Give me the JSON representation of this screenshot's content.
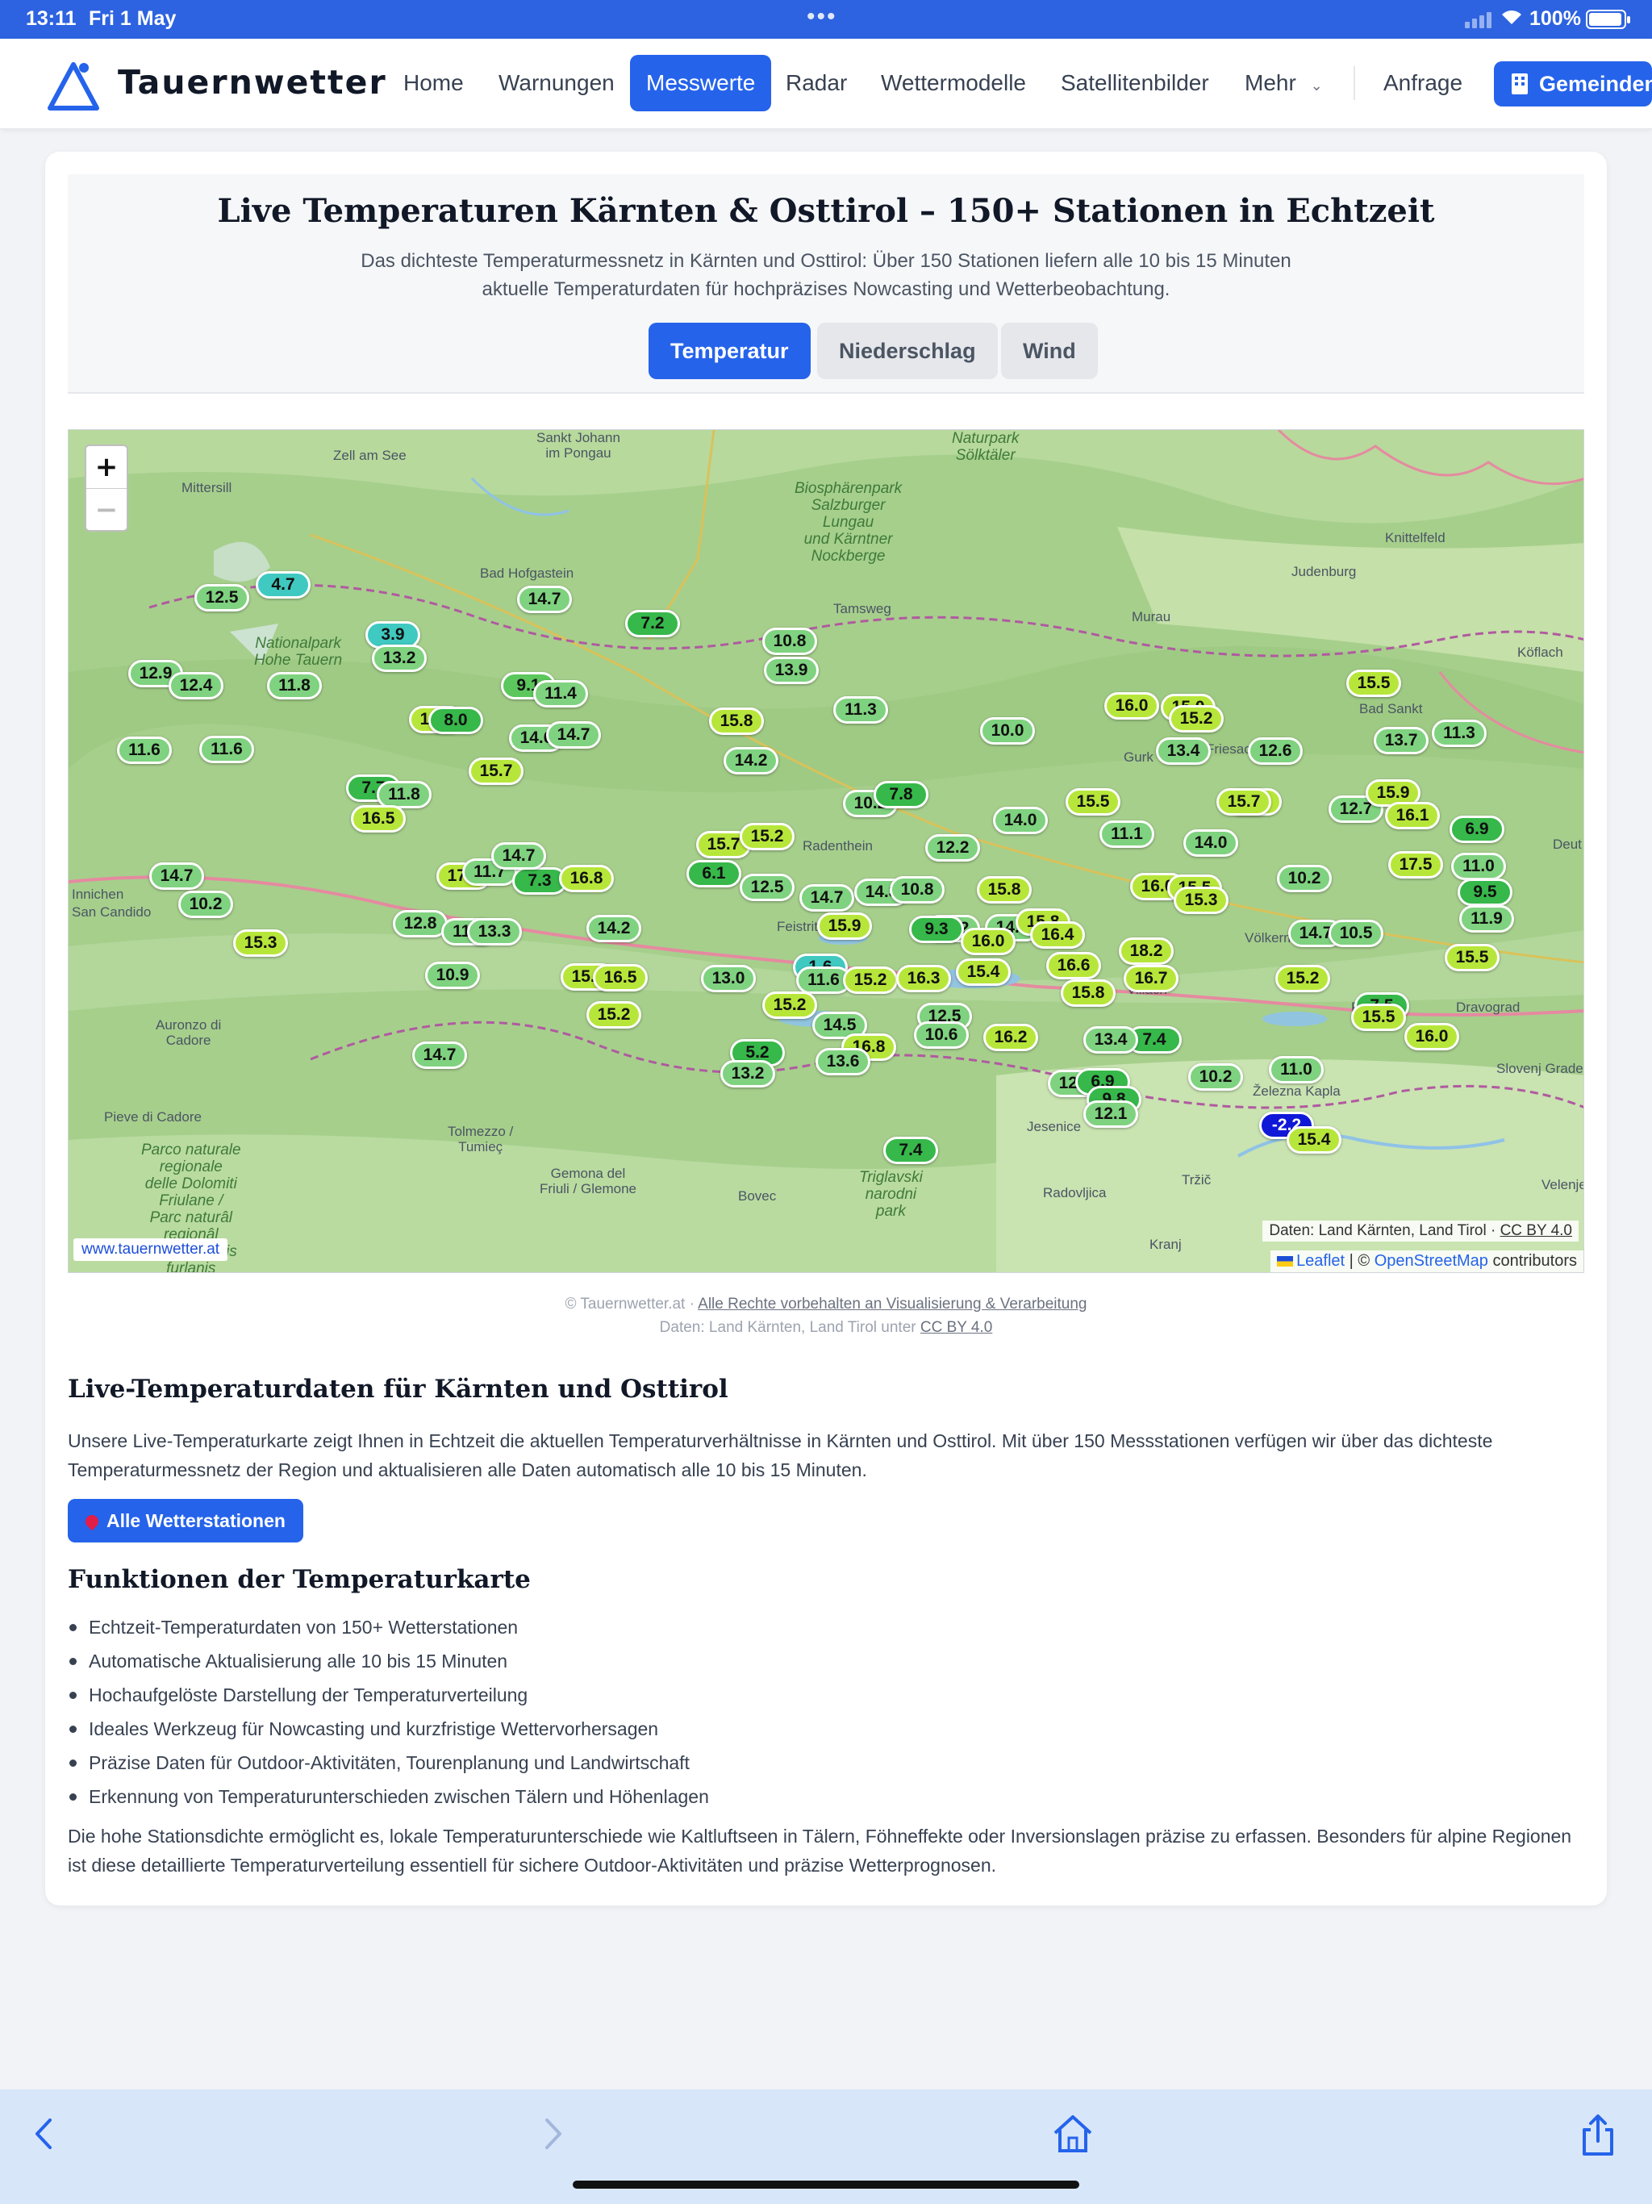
{
  "status": {
    "time": "13:11",
    "date": "Fri 1 May",
    "battery": "100%"
  },
  "header": {
    "brand": "Tauernwetter",
    "nav": [
      "Home",
      "Warnungen",
      "Messwerte",
      "Radar",
      "Wettermodelle",
      "Satellitenbilder",
      "Mehr",
      "Anfrage"
    ],
    "active_nav": "Messwerte",
    "gemeinden_label": "Gemeinden"
  },
  "hero": {
    "title": "Live Temperaturen Kärnten & Osttirol – 150+ Stationen in Echtzeit",
    "subtitle": "Das dichteste Temperaturmessnetz in Kärnten und Osttirol: Über 150 Stationen liefern alle 10 bis 15 Minuten aktuelle Temperaturdaten für hochpräzises Nowcasting und Wetterbeobachtung.",
    "tabs": [
      "Temperatur",
      "Niederschlag",
      "Wind"
    ],
    "active_tab": "Temperatur"
  },
  "map": {
    "zoom_in": "+",
    "zoom_out": "−",
    "places": [
      {
        "name": "Sankt Johann im Pongau",
        "lines": [
          "Sankt Johann",
          "im Pongau"
        ]
      },
      {
        "name": "Zell am See"
      },
      {
        "name": "Mittersill"
      },
      {
        "name": "Bad Hofgastein"
      },
      {
        "name": "Tamsweg"
      },
      {
        "name": "Murau"
      },
      {
        "name": "Knittelfeld"
      },
      {
        "name": "Judenburg"
      },
      {
        "name": "Köflach"
      },
      {
        "name": "Bad Sankt"
      },
      {
        "name": "Innichen"
      },
      {
        "name": "San Candido"
      },
      {
        "name": "Radenthein"
      },
      {
        "name": "Auronzo di Cadore",
        "lines": [
          "Auronzo di",
          "Cadore"
        ]
      },
      {
        "name": "Pieve di Cadore"
      },
      {
        "name": "Tolmezzo / Tumieç",
        "lines": [
          "Tolmezzo /",
          "Tumieç"
        ]
      },
      {
        "name": "Gemona del Friuli / Glemone",
        "lines": [
          "Gemona del",
          "Friuli / Glemone"
        ]
      },
      {
        "name": "Bovec"
      },
      {
        "name": "Jesenice"
      },
      {
        "name": "Radovljica"
      },
      {
        "name": "Tržič"
      },
      {
        "name": "Kranj"
      },
      {
        "name": "Völkermarkt"
      },
      {
        "name": "Pliberk"
      },
      {
        "name": "Dravograd"
      },
      {
        "name": "Slovenj Grade"
      },
      {
        "name": "Železna Kapla"
      },
      {
        "name": "Velenje"
      },
      {
        "name": "Gurk"
      },
      {
        "name": "Friesach"
      },
      {
        "name": "Villach"
      },
      {
        "name": "Feistritz"
      },
      {
        "name": "Deut"
      }
    ],
    "parks": [
      {
        "lines": [
          "Nationalpark",
          "Hohe Tauern"
        ]
      },
      {
        "lines": [
          "Biosphärenpark",
          "Salzburger",
          "Lungau",
          "und Kärntner",
          "Nockberge"
        ]
      },
      {
        "lines": [
          "Naturpark",
          "Sölktäler"
        ]
      },
      {
        "lines": [
          "Parco naturale",
          "regionale",
          "delle Dolomiti",
          "Friulane /",
          "Parc naturâl",
          "regjonâl",
          "des Dolomitis",
          "furlanis"
        ]
      },
      {
        "lines": [
          "Triglavski",
          "narodni",
          "park"
        ]
      }
    ],
    "markers": [
      {
        "v": "12.5",
        "c": "#7fd27f"
      },
      {
        "v": "4.7",
        "c": "#3fc9c0"
      },
      {
        "v": "14.7",
        "c": "#7fd27f"
      },
      {
        "v": "3.9",
        "c": "#3fc9c0"
      },
      {
        "v": "13.2",
        "c": "#7fd27f"
      },
      {
        "v": "7.2",
        "c": "#37b84a"
      },
      {
        "v": "10.8",
        "c": "#7fd27f"
      },
      {
        "v": "13.9",
        "c": "#7fd27f"
      },
      {
        "v": "12.9",
        "c": "#7fd27f"
      },
      {
        "v": "12.4",
        "c": "#7fd27f"
      },
      {
        "v": "11.8",
        "c": "#7fd27f"
      },
      {
        "v": "9.1",
        "c": "#5cc75c"
      },
      {
        "v": "11.4",
        "c": "#7fd27f"
      },
      {
        "v": "15.8",
        "c": "#b7e63a"
      },
      {
        "v": "8.0",
        "c": "#37b84a"
      },
      {
        "v": "14.6",
        "c": "#7fd27f"
      },
      {
        "v": "14.7",
        "c": "#7fd27f"
      },
      {
        "v": "15.8",
        "c": "#b7e63a"
      },
      {
        "v": "11.3",
        "c": "#7fd27f"
      },
      {
        "v": "10.0",
        "c": "#7fd27f"
      },
      {
        "v": "16.0",
        "c": "#b7e63a"
      },
      {
        "v": "15.0",
        "c": "#b7e63a"
      },
      {
        "v": "15.2",
        "c": "#b7e63a"
      },
      {
        "v": "15.5",
        "c": "#b7e63a"
      },
      {
        "v": "11.6",
        "c": "#7fd27f"
      },
      {
        "v": "11.6",
        "c": "#7fd27f"
      },
      {
        "v": "15.7",
        "c": "#b7e63a"
      },
      {
        "v": "14.2",
        "c": "#7fd27f"
      },
      {
        "v": "13.4",
        "c": "#7fd27f"
      },
      {
        "v": "12.6",
        "c": "#7fd27f"
      },
      {
        "v": "13.7",
        "c": "#7fd27f"
      },
      {
        "v": "11.3",
        "c": "#7fd27f"
      },
      {
        "v": "7.7",
        "c": "#37b84a"
      },
      {
        "v": "11.8",
        "c": "#7fd27f"
      },
      {
        "v": "16.5",
        "c": "#b7e63a"
      },
      {
        "v": "10.2",
        "c": "#7fd27f"
      },
      {
        "v": "7.8",
        "c": "#37b84a"
      },
      {
        "v": "14.0",
        "c": "#7fd27f"
      },
      {
        "v": "15.5",
        "c": "#b7e63a"
      },
      {
        "v": "15.9",
        "c": "#b7e63a"
      },
      {
        "v": "15.7",
        "c": "#b7e63a"
      },
      {
        "v": "12.7",
        "c": "#7fd27f"
      },
      {
        "v": "15.9",
        "c": "#b7e63a"
      },
      {
        "v": "16.1",
        "c": "#b7e63a"
      },
      {
        "v": "15.7",
        "c": "#b7e63a"
      },
      {
        "v": "15.2",
        "c": "#b7e63a"
      },
      {
        "v": "6.9",
        "c": "#37b84a"
      },
      {
        "v": "11.1",
        "c": "#7fd27f"
      },
      {
        "v": "14.0",
        "c": "#7fd27f"
      },
      {
        "v": "12.2",
        "c": "#7fd27f"
      },
      {
        "v": "14.7",
        "c": "#7fd27f"
      },
      {
        "v": "17.0",
        "c": "#b7e63a"
      },
      {
        "v": "11.7",
        "c": "#7fd27f"
      },
      {
        "v": "7.3",
        "c": "#37b84a"
      },
      {
        "v": "14.7",
        "c": "#7fd27f"
      },
      {
        "v": "16.8",
        "c": "#b7e63a"
      },
      {
        "v": "6.1",
        "c": "#37b84a"
      },
      {
        "v": "17.5",
        "c": "#b7e63a"
      },
      {
        "v": "11.0",
        "c": "#7fd27f"
      },
      {
        "v": "10.2",
        "c": "#7fd27f"
      },
      {
        "v": "12.5",
        "c": "#7fd27f"
      },
      {
        "v": "14.7",
        "c": "#7fd27f"
      },
      {
        "v": "14.3",
        "c": "#7fd27f"
      },
      {
        "v": "10.8",
        "c": "#7fd27f"
      },
      {
        "v": "15.8",
        "c": "#b7e63a"
      },
      {
        "v": "16.0",
        "c": "#b7e63a"
      },
      {
        "v": "15.5",
        "c": "#b7e63a"
      },
      {
        "v": "9.5",
        "c": "#37b84a"
      },
      {
        "v": "12.2",
        "c": "#7fd27f"
      },
      {
        "v": "11.9",
        "c": "#7fd27f"
      },
      {
        "v": "15.3",
        "c": "#b7e63a"
      },
      {
        "v": "10.2",
        "c": "#7fd27f"
      },
      {
        "v": "12.8",
        "c": "#7fd27f"
      },
      {
        "v": "11.3",
        "c": "#7fd27f"
      },
      {
        "v": "13.3",
        "c": "#7fd27f"
      },
      {
        "v": "14.2",
        "c": "#7fd27f"
      },
      {
        "v": "15.9",
        "c": "#b7e63a"
      },
      {
        "v": "9.3",
        "c": "#37b84a"
      },
      {
        "v": "14.8",
        "c": "#7fd27f"
      },
      {
        "v": "15.8",
        "c": "#b7e63a"
      },
      {
        "v": "16.4",
        "c": "#b7e63a"
      },
      {
        "v": "14.7",
        "c": "#7fd27f"
      },
      {
        "v": "10.5",
        "c": "#7fd27f"
      },
      {
        "v": "15.3",
        "c": "#b7e63a"
      },
      {
        "v": "16.0",
        "c": "#b7e63a"
      },
      {
        "v": "18.2",
        "c": "#b7e63a"
      },
      {
        "v": "15.5",
        "c": "#b7e63a"
      },
      {
        "v": "16.6",
        "c": "#b7e63a"
      },
      {
        "v": "16.7",
        "c": "#b7e63a"
      },
      {
        "v": "10.9",
        "c": "#7fd27f"
      },
      {
        "v": "15.6",
        "c": "#b7e63a"
      },
      {
        "v": "16.5",
        "c": "#b7e63a"
      },
      {
        "v": "13.0",
        "c": "#7fd27f"
      },
      {
        "v": "1.6",
        "c": "#3fc9c0"
      },
      {
        "v": "11.6",
        "c": "#7fd27f"
      },
      {
        "v": "15.2",
        "c": "#b7e63a"
      },
      {
        "v": "16.3",
        "c": "#b7e63a"
      },
      {
        "v": "15.4",
        "c": "#b7e63a"
      },
      {
        "v": "15.8",
        "c": "#b7e63a"
      },
      {
        "v": "15.2",
        "c": "#b7e63a"
      },
      {
        "v": "7.5",
        "c": "#37b84a"
      },
      {
        "v": "15.2",
        "c": "#b7e63a"
      },
      {
        "v": "15.2",
        "c": "#b7e63a"
      },
      {
        "v": "15.5",
        "c": "#b7e63a"
      },
      {
        "v": "12.5",
        "c": "#7fd27f"
      },
      {
        "v": "14.5",
        "c": "#7fd27f"
      },
      {
        "v": "10.6",
        "c": "#7fd27f"
      },
      {
        "v": "16.0",
        "c": "#b7e63a"
      },
      {
        "v": "16.8",
        "c": "#b7e63a"
      },
      {
        "v": "16.2",
        "c": "#b7e63a"
      },
      {
        "v": "7.4",
        "c": "#37b84a"
      },
      {
        "v": "13.4",
        "c": "#7fd27f"
      },
      {
        "v": "14.7",
        "c": "#7fd27f"
      },
      {
        "v": "5.2",
        "c": "#37b84a"
      },
      {
        "v": "13.6",
        "c": "#7fd27f"
      },
      {
        "v": "13.2",
        "c": "#7fd27f"
      },
      {
        "v": "11.0",
        "c": "#7fd27f"
      },
      {
        "v": "10.2",
        "c": "#7fd27f"
      },
      {
        "v": "12.9",
        "c": "#7fd27f"
      },
      {
        "v": "6.9",
        "c": "#37b84a"
      },
      {
        "v": "9.8",
        "c": "#37b84a"
      },
      {
        "v": "12.1",
        "c": "#7fd27f"
      },
      {
        "v": "-2.2",
        "c": "#1018d8"
      },
      {
        "v": "15.4",
        "c": "#b7e63a"
      },
      {
        "v": "7.4",
        "c": "#37b84a"
      }
    ],
    "site_badge": "www.tauernwetter.at",
    "attribution_data": "Daten: Land Kärnten, Land Tirol · ",
    "attribution_license": "CC BY 4.0",
    "attribution_leaflet": "Leaflet",
    "attribution_osm_prefix": " | © ",
    "attribution_osm": "OpenStreetMap",
    "attribution_osm_suffix": " contributors"
  },
  "copyright": {
    "line1_prefix": "© Tauernwetter.at · ",
    "line1_link": "Alle Rechte vorbehalten an Visualisierung & Verarbeitung",
    "line2_prefix": "Daten: Land Kärnten, Land Tirol unter ",
    "line2_link": "CC BY 4.0"
  },
  "section1": {
    "title": "Live-Temperaturdaten für Kärnten und Osttirol",
    "text": "Unsere Live-Temperaturkarte zeigt Ihnen in Echtzeit die aktuellen Temperaturverhältnisse in Kärnten und Osttirol. Mit über 150 Messstationen verfügen wir über das dichteste Temperaturmessnetz der Region und aktualisieren alle Daten automatisch alle 10 bis 15 Minuten.",
    "button": "Alle Wetterstationen"
  },
  "section2": {
    "title": "Funktionen der Temperaturkarte",
    "items": [
      "Echtzeit-Temperaturdaten von 150+ Wetterstationen",
      "Automatische Aktualisierung alle 10 bis 15 Minuten",
      "Hochaufgelöste Darstellung der Temperaturverteilung",
      "Ideales Werkzeug für Nowcasting und kurzfristige Wettervorhersagen",
      "Präzise Daten für Outdoor-Aktivitäten, Tourenplanung und Landwirtschaft",
      "Erkennung von Temperaturunterschieden zwischen Tälern und Höhenlagen"
    ],
    "text": "Die hohe Stationsdichte ermöglicht es, lokale Temperaturunterschiede wie Kaltluftseen in Tälern, Föhneffekte oder Inversionslagen präzise zu erfassen. Besonders für alpine Regionen ist diese detaillierte Temperaturverteilung essentiell für sichere Outdoor-Aktivitäten und präzise Wetterprognosen."
  }
}
